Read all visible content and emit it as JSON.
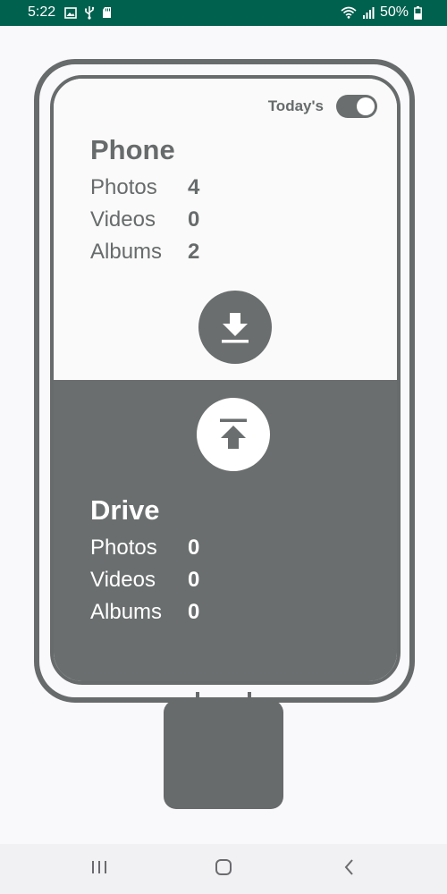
{
  "status_bar": {
    "time": "5:22",
    "battery": "50%",
    "background_color": "#01614f",
    "icons_left": [
      "image-icon",
      "usb-icon",
      "sd-card-icon"
    ],
    "icons_right": [
      "wifi-icon",
      "signal-icon",
      "battery-icon"
    ]
  },
  "toggle": {
    "label": "Today's",
    "enabled": true
  },
  "phone_section": {
    "title": "Phone",
    "stats": [
      {
        "label": "Photos",
        "value": "4"
      },
      {
        "label": "Videos",
        "value": "0"
      },
      {
        "label": "Albums",
        "value": "2"
      }
    ],
    "action_icon": "download-icon"
  },
  "drive_section": {
    "title": "Drive",
    "stats": [
      {
        "label": "Photos",
        "value": "0"
      },
      {
        "label": "Videos",
        "value": "0"
      },
      {
        "label": "Albums",
        "value": "0"
      }
    ],
    "action_icon": "upload-icon"
  },
  "colors": {
    "primary_gray": "#676b6b",
    "background": "#f9f8fa",
    "status_bar": "#01614f"
  },
  "nav_bar": {
    "buttons": [
      "recent-apps-icon",
      "home-icon",
      "back-icon"
    ]
  }
}
